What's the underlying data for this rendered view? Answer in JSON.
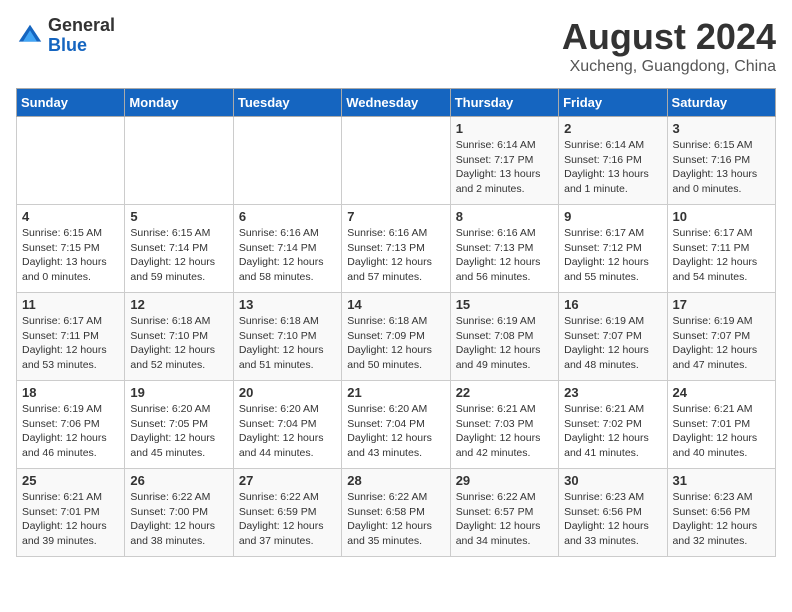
{
  "header": {
    "logo_general": "General",
    "logo_blue": "Blue",
    "month_year": "August 2024",
    "location": "Xucheng, Guangdong, China"
  },
  "days_of_week": [
    "Sunday",
    "Monday",
    "Tuesday",
    "Wednesday",
    "Thursday",
    "Friday",
    "Saturday"
  ],
  "weeks": [
    [
      {
        "day": "",
        "content": ""
      },
      {
        "day": "",
        "content": ""
      },
      {
        "day": "",
        "content": ""
      },
      {
        "day": "",
        "content": ""
      },
      {
        "day": "1",
        "content": "Sunrise: 6:14 AM\nSunset: 7:17 PM\nDaylight: 13 hours\nand 2 minutes."
      },
      {
        "day": "2",
        "content": "Sunrise: 6:14 AM\nSunset: 7:16 PM\nDaylight: 13 hours\nand 1 minute."
      },
      {
        "day": "3",
        "content": "Sunrise: 6:15 AM\nSunset: 7:16 PM\nDaylight: 13 hours\nand 0 minutes."
      }
    ],
    [
      {
        "day": "4",
        "content": "Sunrise: 6:15 AM\nSunset: 7:15 PM\nDaylight: 13 hours\nand 0 minutes."
      },
      {
        "day": "5",
        "content": "Sunrise: 6:15 AM\nSunset: 7:14 PM\nDaylight: 12 hours\nand 59 minutes."
      },
      {
        "day": "6",
        "content": "Sunrise: 6:16 AM\nSunset: 7:14 PM\nDaylight: 12 hours\nand 58 minutes."
      },
      {
        "day": "7",
        "content": "Sunrise: 6:16 AM\nSunset: 7:13 PM\nDaylight: 12 hours\nand 57 minutes."
      },
      {
        "day": "8",
        "content": "Sunrise: 6:16 AM\nSunset: 7:13 PM\nDaylight: 12 hours\nand 56 minutes."
      },
      {
        "day": "9",
        "content": "Sunrise: 6:17 AM\nSunset: 7:12 PM\nDaylight: 12 hours\nand 55 minutes."
      },
      {
        "day": "10",
        "content": "Sunrise: 6:17 AM\nSunset: 7:11 PM\nDaylight: 12 hours\nand 54 minutes."
      }
    ],
    [
      {
        "day": "11",
        "content": "Sunrise: 6:17 AM\nSunset: 7:11 PM\nDaylight: 12 hours\nand 53 minutes."
      },
      {
        "day": "12",
        "content": "Sunrise: 6:18 AM\nSunset: 7:10 PM\nDaylight: 12 hours\nand 52 minutes."
      },
      {
        "day": "13",
        "content": "Sunrise: 6:18 AM\nSunset: 7:10 PM\nDaylight: 12 hours\nand 51 minutes."
      },
      {
        "day": "14",
        "content": "Sunrise: 6:18 AM\nSunset: 7:09 PM\nDaylight: 12 hours\nand 50 minutes."
      },
      {
        "day": "15",
        "content": "Sunrise: 6:19 AM\nSunset: 7:08 PM\nDaylight: 12 hours\nand 49 minutes."
      },
      {
        "day": "16",
        "content": "Sunrise: 6:19 AM\nSunset: 7:07 PM\nDaylight: 12 hours\nand 48 minutes."
      },
      {
        "day": "17",
        "content": "Sunrise: 6:19 AM\nSunset: 7:07 PM\nDaylight: 12 hours\nand 47 minutes."
      }
    ],
    [
      {
        "day": "18",
        "content": "Sunrise: 6:19 AM\nSunset: 7:06 PM\nDaylight: 12 hours\nand 46 minutes."
      },
      {
        "day": "19",
        "content": "Sunrise: 6:20 AM\nSunset: 7:05 PM\nDaylight: 12 hours\nand 45 minutes."
      },
      {
        "day": "20",
        "content": "Sunrise: 6:20 AM\nSunset: 7:04 PM\nDaylight: 12 hours\nand 44 minutes."
      },
      {
        "day": "21",
        "content": "Sunrise: 6:20 AM\nSunset: 7:04 PM\nDaylight: 12 hours\nand 43 minutes."
      },
      {
        "day": "22",
        "content": "Sunrise: 6:21 AM\nSunset: 7:03 PM\nDaylight: 12 hours\nand 42 minutes."
      },
      {
        "day": "23",
        "content": "Sunrise: 6:21 AM\nSunset: 7:02 PM\nDaylight: 12 hours\nand 41 minutes."
      },
      {
        "day": "24",
        "content": "Sunrise: 6:21 AM\nSunset: 7:01 PM\nDaylight: 12 hours\nand 40 minutes."
      }
    ],
    [
      {
        "day": "25",
        "content": "Sunrise: 6:21 AM\nSunset: 7:01 PM\nDaylight: 12 hours\nand 39 minutes."
      },
      {
        "day": "26",
        "content": "Sunrise: 6:22 AM\nSunset: 7:00 PM\nDaylight: 12 hours\nand 38 minutes."
      },
      {
        "day": "27",
        "content": "Sunrise: 6:22 AM\nSunset: 6:59 PM\nDaylight: 12 hours\nand 37 minutes."
      },
      {
        "day": "28",
        "content": "Sunrise: 6:22 AM\nSunset: 6:58 PM\nDaylight: 12 hours\nand 35 minutes."
      },
      {
        "day": "29",
        "content": "Sunrise: 6:22 AM\nSunset: 6:57 PM\nDaylight: 12 hours\nand 34 minutes."
      },
      {
        "day": "30",
        "content": "Sunrise: 6:23 AM\nSunset: 6:56 PM\nDaylight: 12 hours\nand 33 minutes."
      },
      {
        "day": "31",
        "content": "Sunrise: 6:23 AM\nSunset: 6:56 PM\nDaylight: 12 hours\nand 32 minutes."
      }
    ]
  ]
}
